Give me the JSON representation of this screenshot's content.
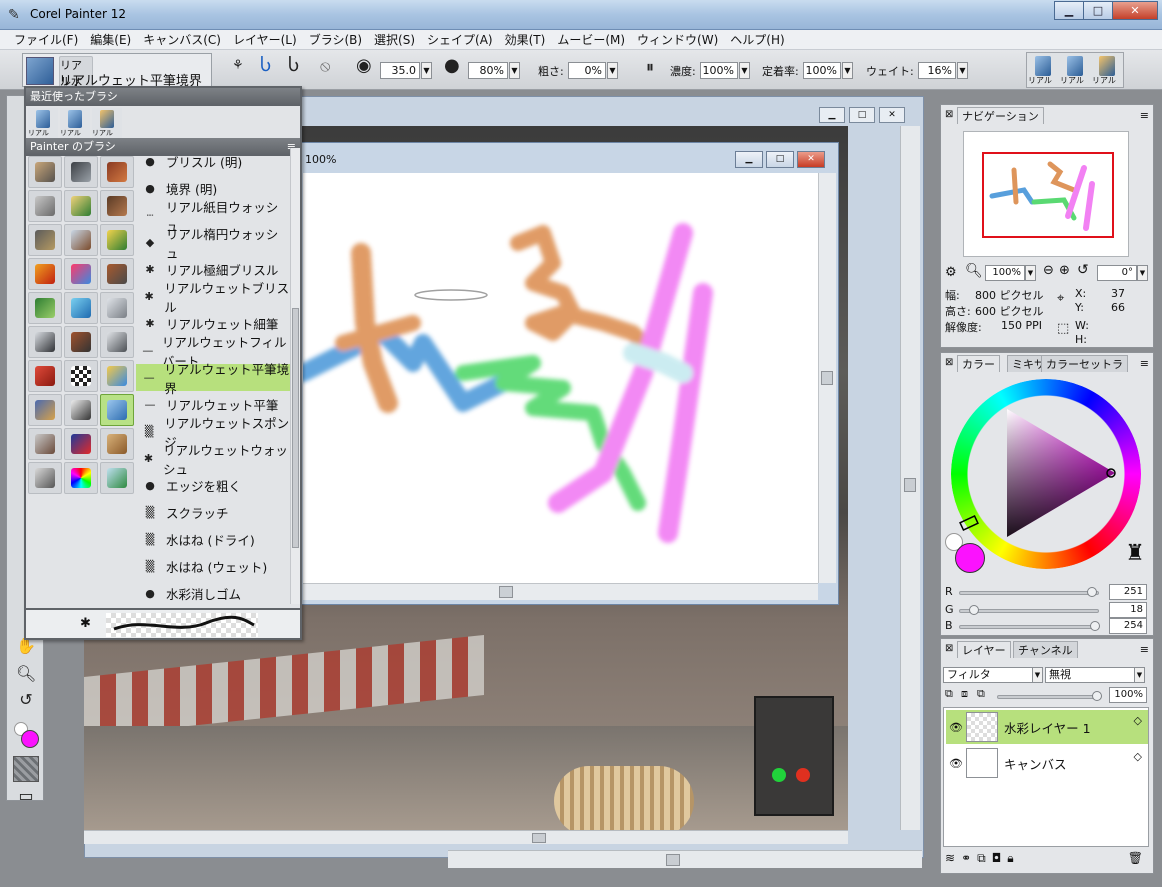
{
  "window": {
    "title": "Corel Painter 12",
    "minimize": "▁",
    "maximize": "□",
    "close": "✕"
  },
  "menu": [
    "ファイル(F)",
    "編集(E)",
    "キャンバス(C)",
    "レイヤー(L)",
    "ブラシ(B)",
    "選択(S)",
    "シェイプ(A)",
    "効果(T)",
    "ムービー(M)",
    "ウィンドウ(W)",
    "ヘルプ(H)"
  ],
  "propbar": {
    "brush_category": "リアル水彩",
    "brush_variant": "リアルウェット平筆境界",
    "size_value": "35.0",
    "opacity_value": "80%",
    "coarseness_label": "粗さ:",
    "coarseness_value": "0%",
    "concentration_label": "濃度:",
    "concentration_value": "100%",
    "settle_label": "定着率:",
    "settle_value": "100%",
    "weight_label": "ウェイト:",
    "weight_value": "16%",
    "recent_labels": [
      "リアル",
      "リアル",
      "リアル"
    ]
  },
  "brush_selector": {
    "recent_header": "最近使ったブラシ",
    "recent_labels": [
      "リアル",
      "リアル",
      "リアル"
    ],
    "brushes_header": "Painter のブラシ",
    "variants": [
      {
        "icon": "●",
        "label": "ブリスル (明)"
      },
      {
        "icon": "●",
        "label": "境界 (明)"
      },
      {
        "icon": "┈",
        "label": "リアル紙目ウォッシュ"
      },
      {
        "icon": "◆",
        "label": "リアル楕円ウォッシュ"
      },
      {
        "icon": "✱",
        "label": "リアル極細ブリスル"
      },
      {
        "icon": "✱",
        "label": "リアルウェットブリスル"
      },
      {
        "icon": "✱",
        "label": "リアルウェット細筆"
      },
      {
        "icon": "—",
        "label": "リアルウェットフィルバート"
      },
      {
        "icon": "—",
        "label": "リアルウェット平筆境界"
      },
      {
        "icon": "—",
        "label": "リアルウェット平筆"
      },
      {
        "icon": "▒",
        "label": "リアルウェットスポンジ"
      },
      {
        "icon": "✱",
        "label": "リアルウェットウォッシュ"
      },
      {
        "icon": "●",
        "label": "エッジを粗く"
      },
      {
        "icon": "▒",
        "label": "スクラッチ"
      },
      {
        "icon": "▒",
        "label": "水はね (ドライ)"
      },
      {
        "icon": "▒",
        "label": "水はね (ウェット)"
      },
      {
        "icon": "●",
        "label": "水彩消しゴム"
      }
    ],
    "selected_variant": "リアルウェット平筆境界"
  },
  "document": {
    "zoom_label": "100%"
  },
  "navigator": {
    "tab": "ナビゲーション",
    "zoom": "100%",
    "rotate": "0°",
    "width_label": "幅:",
    "width_value": "800 ピクセル",
    "height_label": "高さ:",
    "height_value": "600 ピクセル",
    "res_label": "解像度:",
    "res_value": "150 PPI",
    "x_label": "X:",
    "x_value": "37",
    "y_label": "Y:",
    "y_value": "66",
    "w_label": "W:",
    "h_label": "H:"
  },
  "color": {
    "tabs": [
      "カラー",
      "ミキサ",
      "カラーセットラ"
    ],
    "r_label": "R",
    "g_label": "G",
    "b_label": "B",
    "r": "251",
    "g": "18",
    "b": "254",
    "r_level": 0.98,
    "g_level": 0.07,
    "b_level": 1.0,
    "main_color": "#fb12fe"
  },
  "layers": {
    "tabs": [
      "レイヤー",
      "チャンネル"
    ],
    "filter": "フィルタ",
    "composite": "無視",
    "opacity": "100%",
    "items": [
      {
        "name": "水彩レイヤー 1",
        "selected": true
      },
      {
        "name": "キャンバス",
        "selected": false
      }
    ]
  }
}
